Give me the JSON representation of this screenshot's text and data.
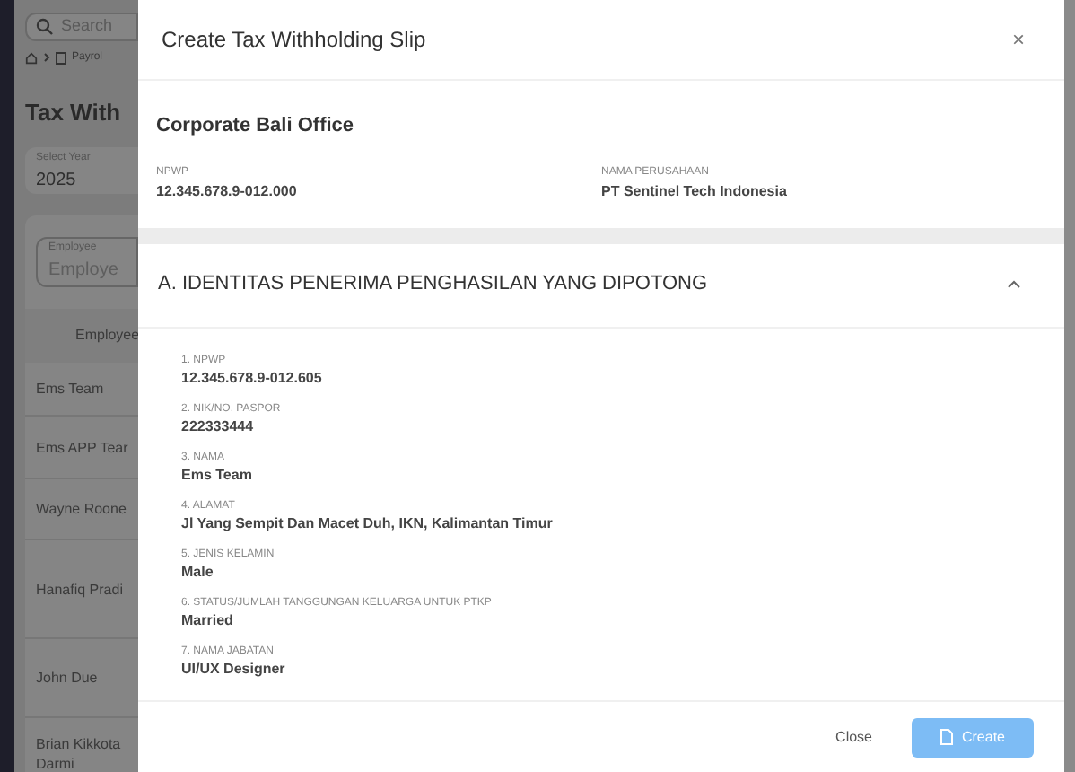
{
  "background": {
    "search_placeholder": "Search",
    "breadcrumb": "Payrol",
    "page_title": "Tax With",
    "year_field": {
      "label": "Select Year",
      "value": "2025"
    },
    "employee_field": {
      "label": "Employee",
      "placeholder": "Employe"
    },
    "table_header": "Employee",
    "rows": [
      {
        "name": "Ems Team"
      },
      {
        "name": "Ems APP Tear"
      },
      {
        "name": "Wayne Roone"
      },
      {
        "name": "Hanafiq Pradi"
      },
      {
        "name": "John Due"
      },
      {
        "name": "Brian Kikkota Darmi"
      }
    ]
  },
  "modal": {
    "title": "Create Tax Withholding Slip",
    "close_icon": "×",
    "company": {
      "name": "Corporate Bali Office",
      "fields": [
        {
          "label": "NPWP",
          "value": "12.345.678.9-012.000"
        },
        {
          "label": "NAMA PERUSAHAAN",
          "value": "PT Sentinel Tech Indonesia"
        }
      ]
    },
    "section": {
      "title": "A. IDENTITAS PENERIMA PENGHASILAN YANG DIPOTONG",
      "expanded": true,
      "fields": [
        {
          "label": "1. NPWP",
          "value": "12.345.678.9-012.605"
        },
        {
          "label": "2. NIK/NO. PASPOR",
          "value": "222333444"
        },
        {
          "label": "3. NAMA",
          "value": "Ems Team"
        },
        {
          "label": "4. ALAMAT",
          "value": "Jl Yang Sempit Dan Macet Duh, IKN, Kalimantan Timur"
        },
        {
          "label": "5. JENIS KELAMIN",
          "value": "Male"
        },
        {
          "label": "6. STATUS/JUMLAH TANGGUNGAN KELUARGA UNTUK PTKP",
          "value": "Married"
        },
        {
          "label": "7. NAMA JABATAN",
          "value": "UI/UX Designer"
        }
      ]
    },
    "buttons": {
      "close": "Close",
      "create": {
        "label": "Create",
        "disabled": true
      }
    }
  }
}
